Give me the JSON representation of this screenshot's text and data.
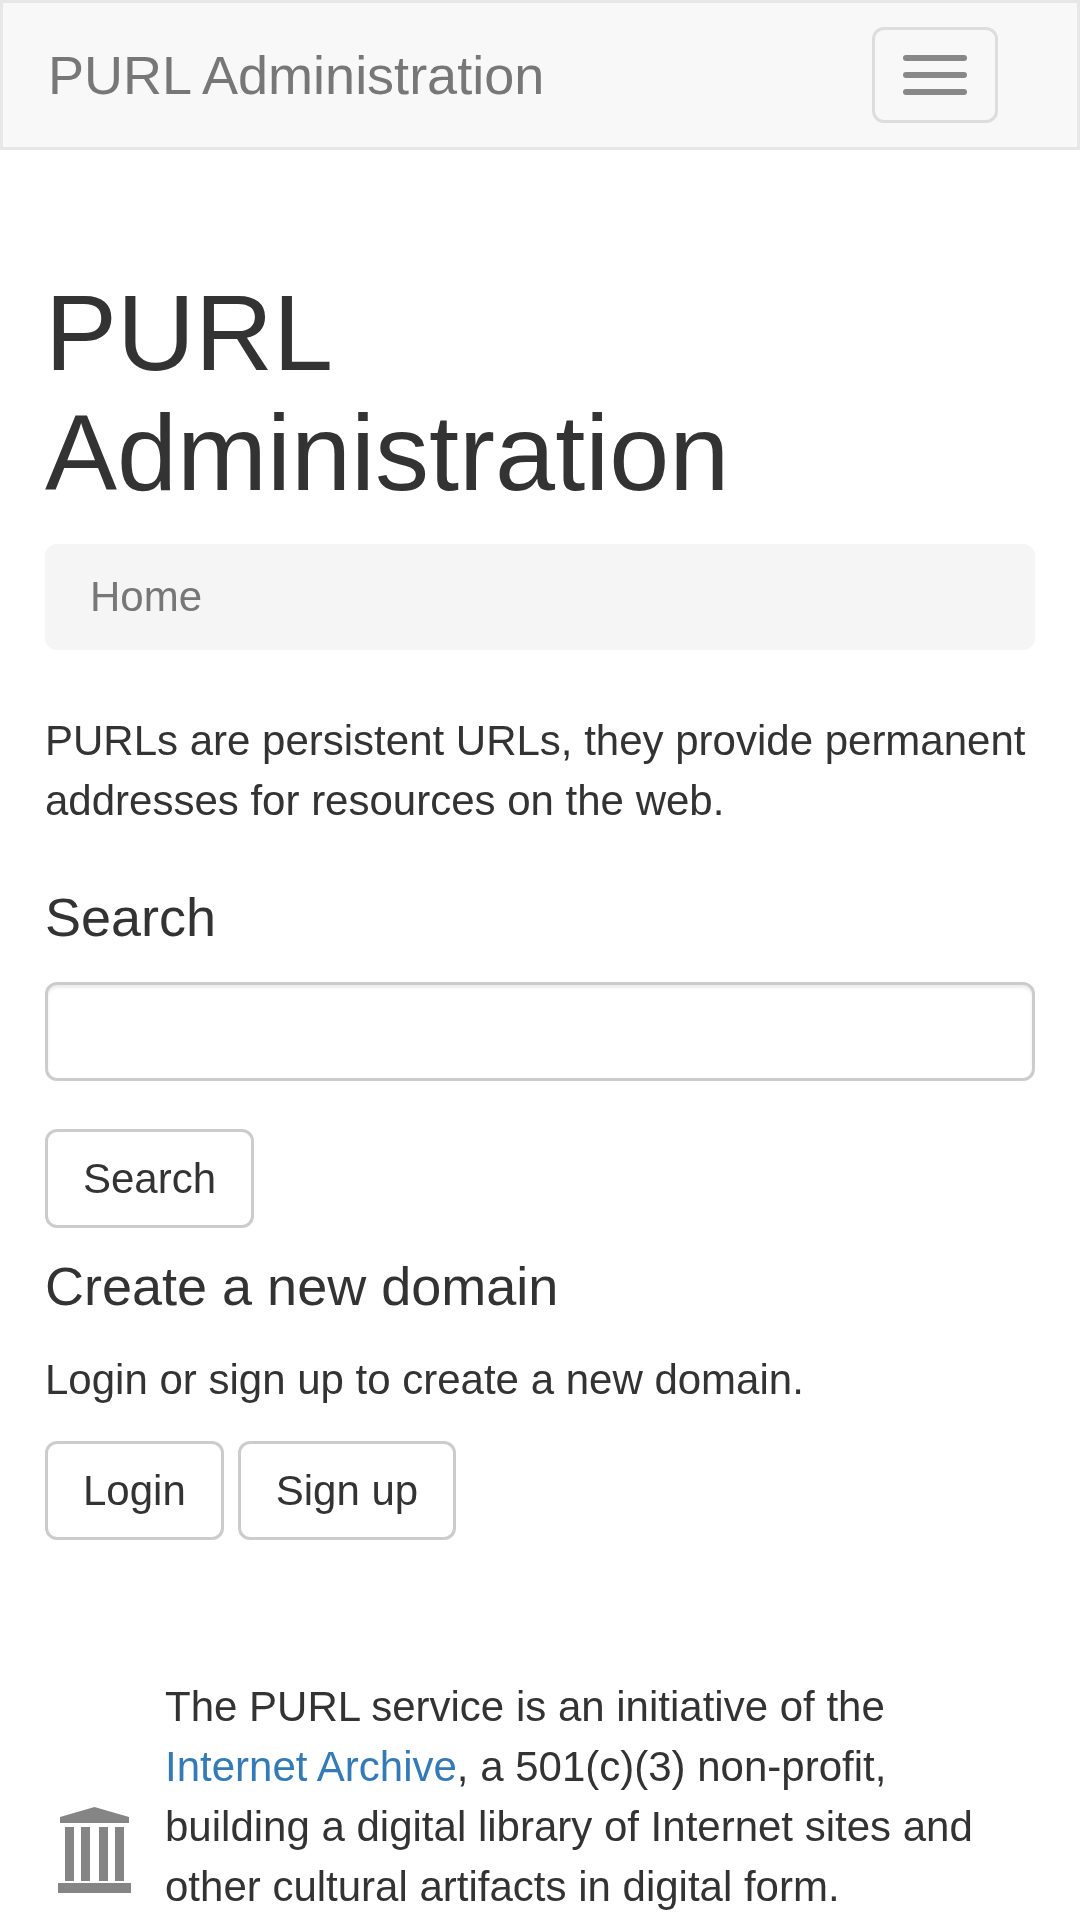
{
  "navbar": {
    "brand": "PURL Administration"
  },
  "title": "PURL Administration",
  "breadcrumb": [
    {
      "label": "Home",
      "active": true
    }
  ],
  "intro": "PURLs are persistent URLs, they provide permanent addresses for resources on the web.",
  "search": {
    "heading": "Search",
    "button": "Search"
  },
  "create_domain": {
    "heading": "Create a new domain",
    "text": "Login or sign up to create a new domain.",
    "buttons": [
      "Login",
      "Sign up"
    ]
  },
  "footer": {
    "text_before": "The PURL service is an initiative of the",
    "link": "Internet Archive",
    "text_after": ", a 501(c)(3) non-profit, building a digital library of Internet sites and other cultural artifacts in digital form."
  }
}
